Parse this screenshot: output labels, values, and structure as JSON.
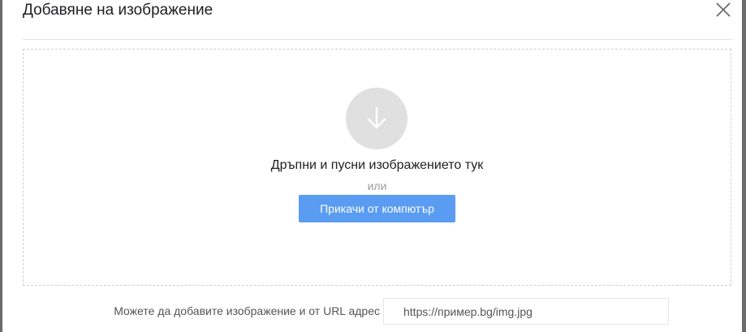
{
  "dialog": {
    "title": "Добавяне на изображение",
    "close_icon": "close-icon"
  },
  "dropzone": {
    "icon": "arrow-down-icon",
    "drop_text": "Дръпни и пусни изображението тук",
    "or_text": "или",
    "upload_button_label": "Прикачи от компютър"
  },
  "url": {
    "label": "Можете да добавите изображение и от URL адрес",
    "placeholder": "https://пример.bg/img.jpg",
    "value": ""
  },
  "colors": {
    "accent": "#5a9cf2",
    "icon_circle": "#e0e0e0",
    "dashed_border": "#cfcfcf"
  }
}
